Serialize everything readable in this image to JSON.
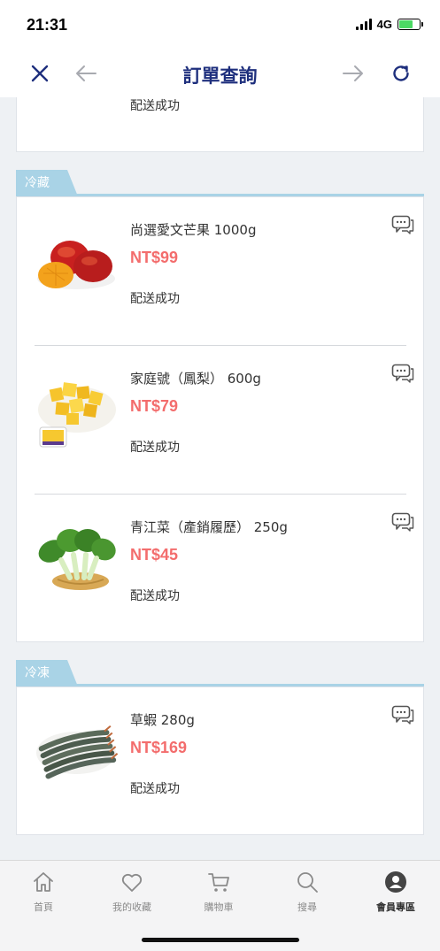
{
  "status_bar": {
    "time": "21:31",
    "network": "4G"
  },
  "nav": {
    "title": "訂單查詢"
  },
  "top_card": {
    "status": "配送成功"
  },
  "sections": [
    {
      "tag": "冷藏",
      "items": [
        {
          "name": "尚選愛文芒果 1000g",
          "price": "NT$99",
          "status": "配送成功"
        },
        {
          "name": "家庭號（鳳梨） 600g",
          "price": "NT$79",
          "status": "配送成功"
        },
        {
          "name": "青江菜（產銷履歷） 250g",
          "price": "NT$45",
          "status": "配送成功"
        }
      ]
    },
    {
      "tag": "冷凍",
      "items": [
        {
          "name": "草蝦 280g",
          "price": "NT$169",
          "status": "配送成功"
        }
      ]
    }
  ],
  "tabbar": {
    "items": [
      {
        "label": "首頁",
        "icon": "home-icon"
      },
      {
        "label": "我的收藏",
        "icon": "heart-icon"
      },
      {
        "label": "購物車",
        "icon": "cart-icon"
      },
      {
        "label": "搜尋",
        "icon": "search-icon"
      },
      {
        "label": "會員專區",
        "icon": "member-icon"
      }
    ],
    "active_index": 4
  },
  "colors": {
    "brand": "#1e2f7d",
    "price": "#f36d6d",
    "tag": "#a9d3e6"
  }
}
